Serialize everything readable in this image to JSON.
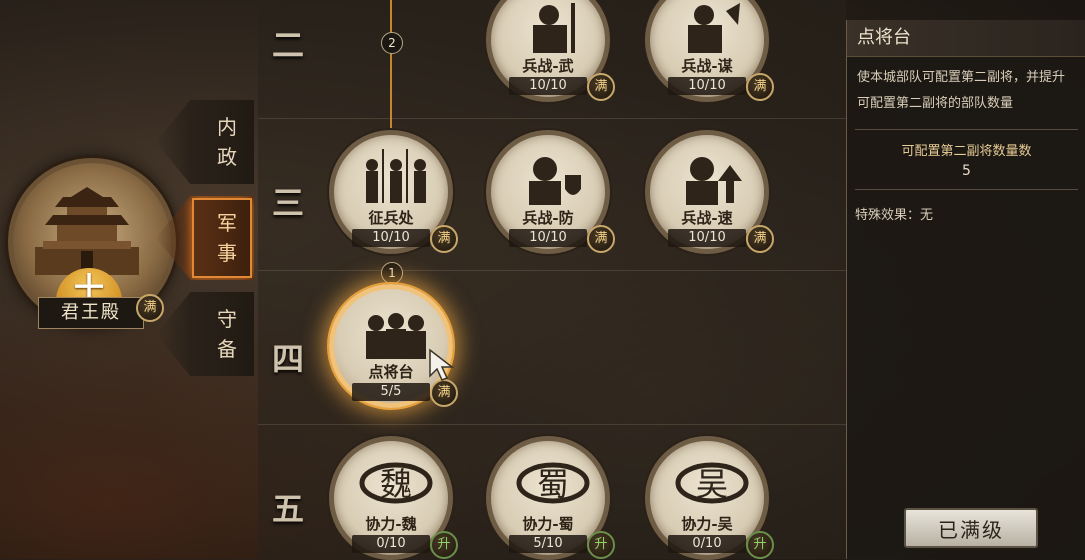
{
  "hall": {
    "name": "君王殿",
    "level": "十",
    "badge": "满"
  },
  "tabs": [
    {
      "label": "内政",
      "active": false
    },
    {
      "label": "军事",
      "active": true
    },
    {
      "label": "守备",
      "active": false
    }
  ],
  "rows": [
    "二",
    "三",
    "四",
    "五"
  ],
  "steps": [
    "2",
    "1"
  ],
  "nodes": {
    "bingzhan_wu": {
      "name": "兵战-武",
      "count": "10/10",
      "badge": "满"
    },
    "bingzhan_mou": {
      "name": "兵战-谋",
      "count": "10/10",
      "badge": "满"
    },
    "zhengbingchu": {
      "name": "征兵处",
      "count": "10/10",
      "badge": "满"
    },
    "bingzhan_fang": {
      "name": "兵战-防",
      "count": "10/10",
      "badge": "满"
    },
    "bingzhan_su": {
      "name": "兵战-速",
      "count": "10/10",
      "badge": "满"
    },
    "dianjiangtai": {
      "name": "点将台",
      "count": "5/5",
      "badge": "满"
    },
    "xieli_wei": {
      "name": "协力-魏",
      "count": "0/10",
      "badge": "升",
      "glyph": "魏"
    },
    "xieli_shu": {
      "name": "协力-蜀",
      "count": "5/10",
      "badge": "升",
      "glyph": "蜀"
    },
    "xieli_wu": {
      "name": "协力-吴",
      "count": "0/10",
      "badge": "升",
      "glyph": "吴"
    }
  },
  "panel": {
    "title": "点将台",
    "description": "使本城部队可配置第二副将，并提升可配置第二副将的部队数量",
    "stat_label": "可配置第二副将数量数",
    "stat_value": "5",
    "special": "特殊效果：无",
    "max_button": "已满级"
  },
  "colors": {
    "accent": "#e08a38",
    "badge_gold": "#f3d38a",
    "badge_green": "#8fd46b"
  }
}
